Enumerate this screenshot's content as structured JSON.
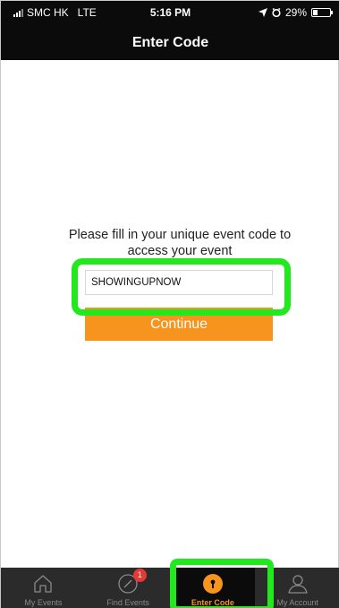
{
  "status_bar": {
    "carrier": "SMC HK",
    "network": "LTE",
    "time": "5:16 PM",
    "battery": "29%",
    "battery_level": 0.29
  },
  "header": {
    "title": "Enter Code"
  },
  "main": {
    "prompt": "Please fill in your unique event code to access your event",
    "code_input": {
      "value": "SHOWINGUPNOW",
      "placeholder": ""
    },
    "continue_label": "Continue"
  },
  "tabbar": {
    "tabs": [
      {
        "label": "My Events",
        "icon": "home-icon",
        "active": false
      },
      {
        "label": "Find Events",
        "icon": "compass-icon",
        "active": false,
        "badge": "1"
      },
      {
        "label": "Enter Code",
        "icon": "keyhole-icon",
        "active": true
      },
      {
        "label": "My Account",
        "icon": "person-icon",
        "active": false
      }
    ]
  },
  "colors": {
    "accent": "#f7941d",
    "header_bg": "#0b0b0b",
    "tabbar_bg": "#2b2b2b",
    "highlight": "#22e81e",
    "badge": "#e53935"
  }
}
